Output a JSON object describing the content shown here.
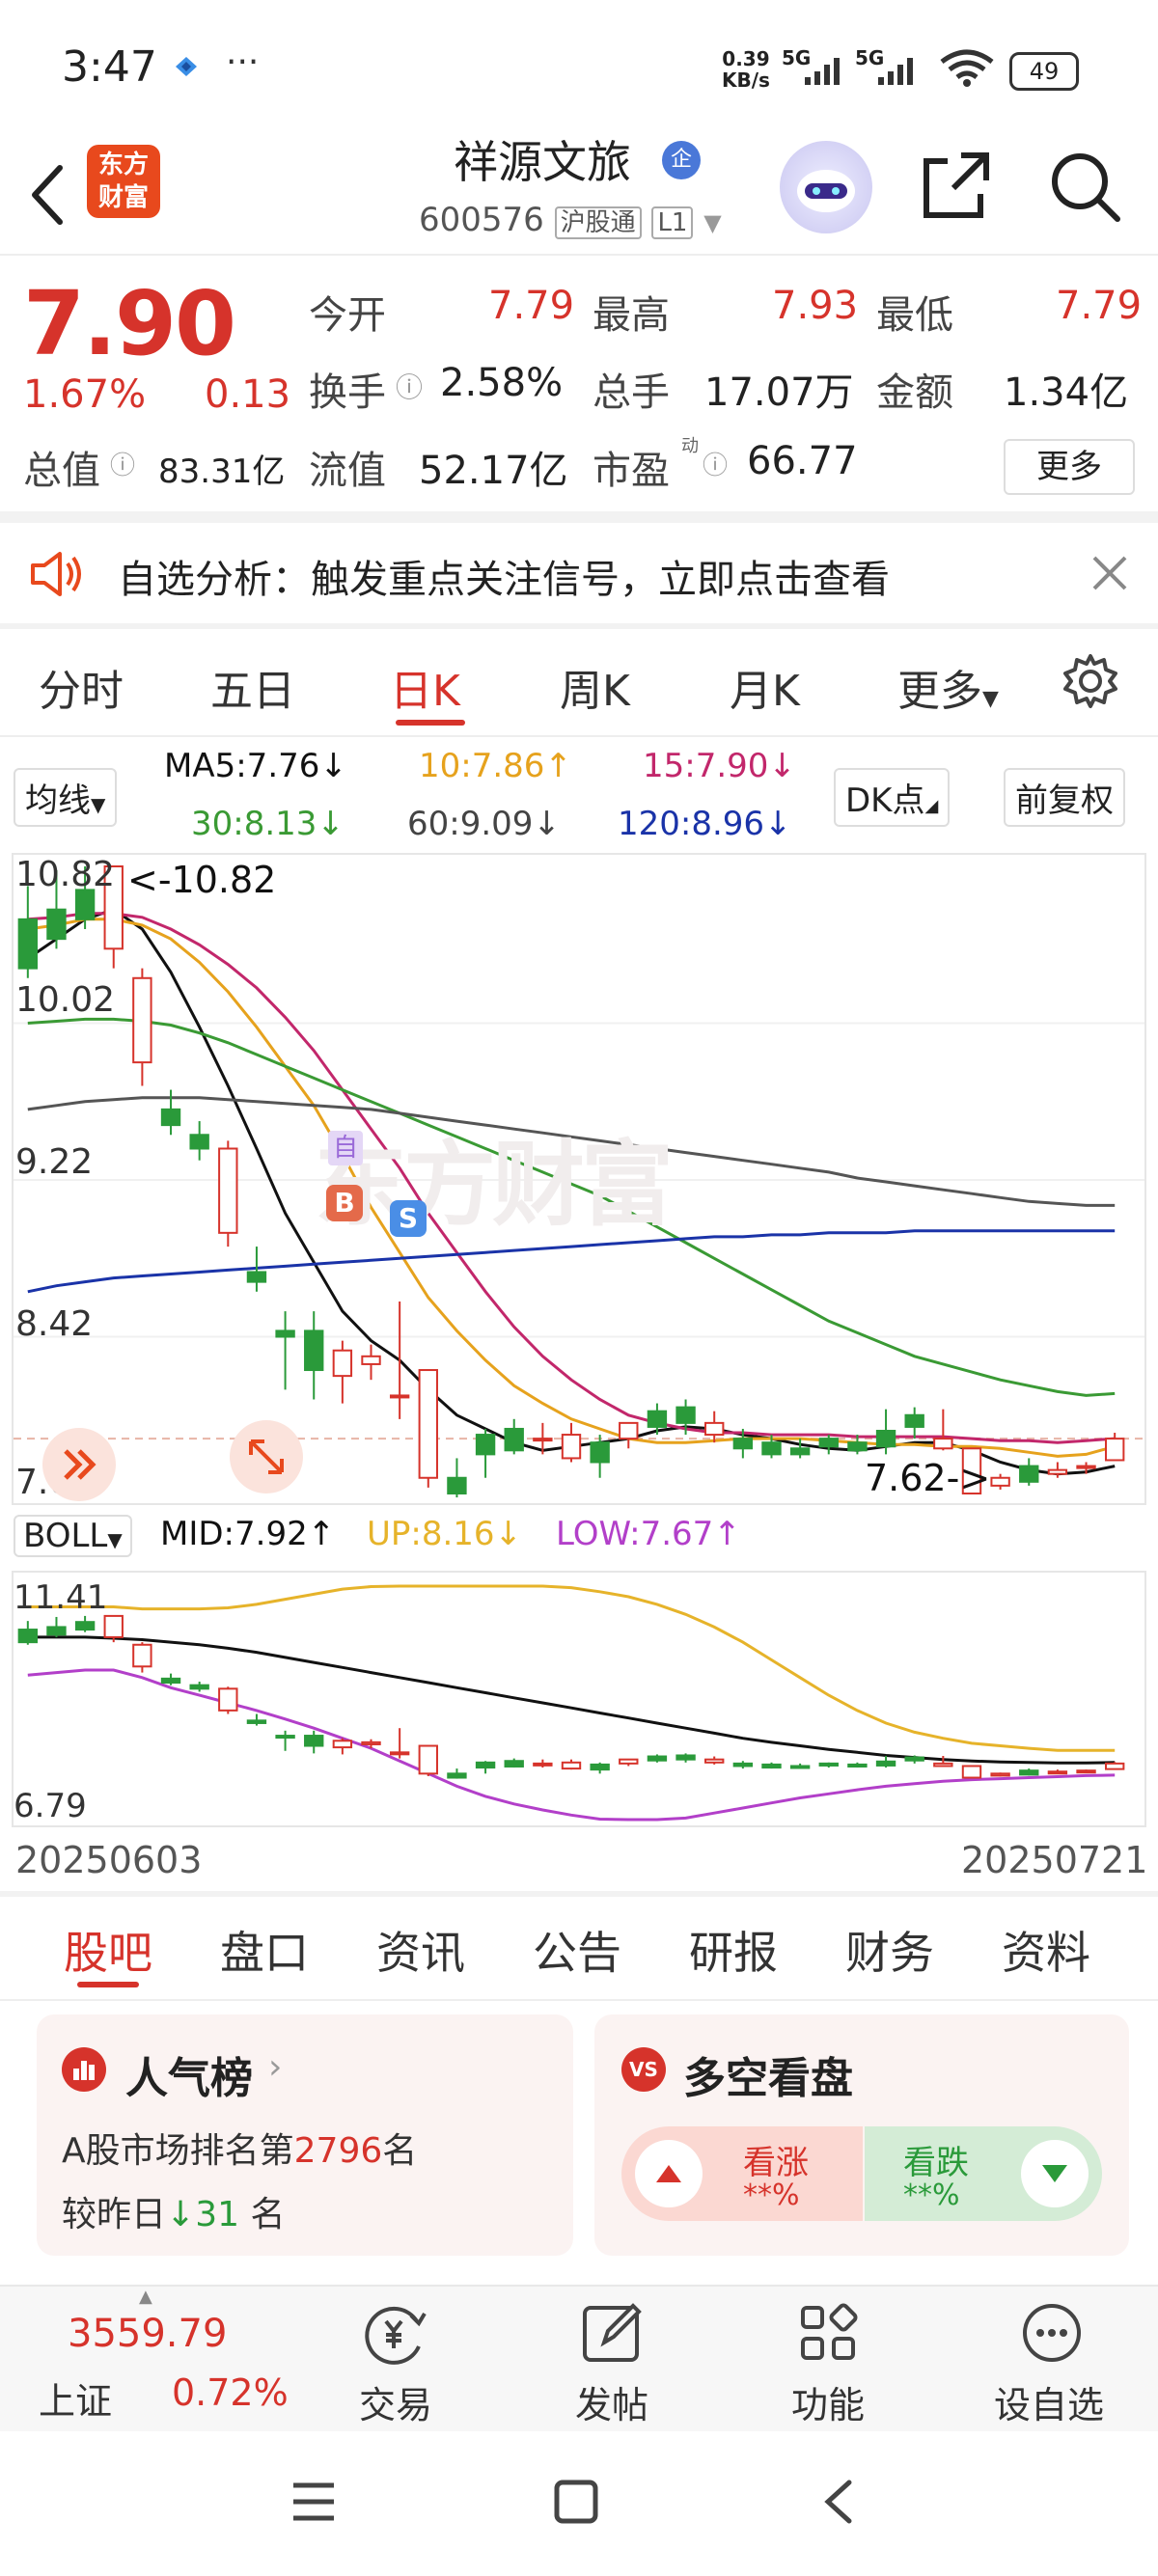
{
  "status_bar": {
    "time": "3:47",
    "dots": "···",
    "net_speed_top": "0.39",
    "net_speed_bottom": "KB/s",
    "sig1": "5G",
    "sig2": "5G",
    "battery": "49"
  },
  "header": {
    "logo_line1": "东方",
    "logo_line2": "财富",
    "title": "祥源文旅",
    "title_badge": "企",
    "code": "600576",
    "tag1": "沪股通",
    "tag2": "L1"
  },
  "quote": {
    "price": "7.90",
    "change_pct": "1.67%",
    "change": "0.13",
    "open_label": "今开",
    "open": "7.79",
    "high_label": "最高",
    "high": "7.93",
    "low_label": "最低",
    "low": "7.79",
    "turnover_label": "换手",
    "turnover": "2.58%",
    "volume_label": "总手",
    "volume": "17.07万",
    "amount_label": "金额",
    "amount": "1.34亿",
    "mktcap_label": "总值",
    "mktcap": "83.31亿",
    "float_label": "流值",
    "float_cap": "52.17亿",
    "pe_label": "市盈",
    "pe_sup": "动",
    "pe": "66.77",
    "more": "更多"
  },
  "banner": {
    "text": "自选分析：触发重点关注信号，立即点击查看"
  },
  "period_tabs": [
    "分时",
    "五日",
    "日K",
    "周K",
    "月K",
    "更多"
  ],
  "period_active": 2,
  "ma_legend": {
    "selector": "均线",
    "ma5": "MA5:7.76↓",
    "ma10": "10:7.86↑",
    "ma15": "15:7.90↓",
    "ma30": "30:8.13↓",
    "ma60": "60:9.09↓",
    "ma120": "120:8.96↓",
    "dk": "DK点",
    "adjust": "前复权"
  },
  "chart_data": [
    {
      "type": "candlestick",
      "y_labels": [
        "10.82",
        "10.02",
        "9.22",
        "8.42",
        "7.62"
      ],
      "ylim": [
        7.62,
        10.82
      ],
      "max_annotation": "<-10.82",
      "min_annotation": "7.62->",
      "watermark": "东方财富",
      "markers": {
        "b": "B",
        "s": "S",
        "zi": "自"
      },
      "candles": [
        [
          10.55,
          10.3,
          10.72,
          10.25
        ],
        [
          10.6,
          10.45,
          10.8,
          10.4
        ],
        [
          10.7,
          10.55,
          10.82,
          10.5
        ],
        [
          10.4,
          10.82,
          10.82,
          10.3
        ],
        [
          9.82,
          10.25,
          10.3,
          9.7
        ],
        [
          9.58,
          9.5,
          9.68,
          9.45
        ],
        [
          9.45,
          9.38,
          9.52,
          9.32
        ],
        [
          8.95,
          9.38,
          9.42,
          8.88
        ],
        [
          8.75,
          8.7,
          8.88,
          8.65
        ],
        [
          8.45,
          8.42,
          8.55,
          8.15
        ],
        [
          8.45,
          8.25,
          8.55,
          8.1
        ],
        [
          8.22,
          8.35,
          8.4,
          8.08
        ],
        [
          8.28,
          8.32,
          8.38,
          8.2
        ],
        [
          8.12,
          8.12,
          8.6,
          8.0
        ],
        [
          7.7,
          8.25,
          8.25,
          7.65
        ],
        [
          7.7,
          7.62,
          7.8,
          7.6
        ],
        [
          7.92,
          7.82,
          7.95,
          7.7
        ],
        [
          7.95,
          7.84,
          8.0,
          7.82
        ],
        [
          7.9,
          7.9,
          7.98,
          7.82
        ],
        [
          7.8,
          7.92,
          7.98,
          7.78
        ],
        [
          7.88,
          7.78,
          7.92,
          7.7
        ],
        [
          7.9,
          7.98,
          7.98,
          7.85
        ],
        [
          8.04,
          7.96,
          8.08,
          7.92
        ],
        [
          8.06,
          7.98,
          8.1,
          7.92
        ],
        [
          7.92,
          7.98,
          8.04,
          7.88
        ],
        [
          7.9,
          7.85,
          7.95,
          7.8
        ],
        [
          7.88,
          7.82,
          7.92,
          7.8
        ],
        [
          7.85,
          7.82,
          7.9,
          7.8
        ],
        [
          7.9,
          7.86,
          7.92,
          7.82
        ],
        [
          7.88,
          7.84,
          7.92,
          7.82
        ],
        [
          7.94,
          7.86,
          8.05,
          7.82
        ],
        [
          8.02,
          7.96,
          8.06,
          7.9
        ],
        [
          7.85,
          7.9,
          8.05,
          7.84
        ],
        [
          7.62,
          7.85,
          7.85,
          7.62
        ],
        [
          7.66,
          7.7,
          7.72,
          7.64
        ],
        [
          7.76,
          7.68,
          7.8,
          7.66
        ],
        [
          7.72,
          7.74,
          7.78,
          7.7
        ],
        [
          7.75,
          7.76,
          7.78,
          7.72
        ],
        [
          7.79,
          7.9,
          7.93,
          7.79
        ]
      ],
      "ma_series": [
        {
          "name": "MA5",
          "color": "#111111",
          "values": [
            10.35,
            10.45,
            10.55,
            10.6,
            10.5,
            10.28,
            10.0,
            9.7,
            9.38,
            9.05,
            8.8,
            8.55,
            8.4,
            8.3,
            8.15,
            8.02,
            7.95,
            7.88,
            7.84,
            7.86,
            7.88,
            7.9,
            7.94,
            7.96,
            7.95,
            7.92,
            7.9,
            7.87,
            7.85,
            7.84,
            7.86,
            7.88,
            7.88,
            7.84,
            7.78,
            7.74,
            7.72,
            7.73,
            7.76
          ]
        },
        {
          "name": "MA10",
          "color": "#e6a21d",
          "values": [
            10.5,
            10.52,
            10.55,
            10.55,
            10.52,
            10.45,
            10.33,
            10.18,
            10.0,
            9.8,
            9.6,
            9.35,
            9.08,
            8.85,
            8.62,
            8.45,
            8.3,
            8.17,
            8.08,
            8.0,
            7.95,
            7.9,
            7.88,
            7.88,
            7.89,
            7.9,
            7.9,
            7.9,
            7.89,
            7.88,
            7.87,
            7.87,
            7.86,
            7.86,
            7.85,
            7.83,
            7.81,
            7.82,
            7.86
          ]
        },
        {
          "name": "MA15",
          "color": "#c2276b",
          "values": [
            10.55,
            10.56,
            10.58,
            10.58,
            10.56,
            10.5,
            10.42,
            10.32,
            10.2,
            10.05,
            9.88,
            9.68,
            9.48,
            9.28,
            9.05,
            8.85,
            8.65,
            8.47,
            8.32,
            8.2,
            8.1,
            8.02,
            7.98,
            7.95,
            7.93,
            7.93,
            7.92,
            7.92,
            7.92,
            7.91,
            7.91,
            7.91,
            7.91,
            7.9,
            7.89,
            7.89,
            7.88,
            7.89,
            7.9
          ]
        },
        {
          "name": "MA30",
          "color": "#3a9a34",
          "values": [
            10.02,
            10.03,
            10.04,
            10.04,
            10.03,
            10.01,
            9.97,
            9.92,
            9.86,
            9.8,
            9.74,
            9.68,
            9.62,
            9.56,
            9.5,
            9.44,
            9.38,
            9.32,
            9.26,
            9.2,
            9.14,
            9.06,
            8.98,
            8.9,
            8.82,
            8.74,
            8.66,
            8.58,
            8.5,
            8.44,
            8.38,
            8.32,
            8.28,
            8.24,
            8.2,
            8.17,
            8.14,
            8.12,
            8.13
          ]
        },
        {
          "name": "MA60",
          "color": "#555555",
          "values": [
            9.58,
            9.6,
            9.62,
            9.63,
            9.64,
            9.64,
            9.64,
            9.63,
            9.62,
            9.61,
            9.6,
            9.59,
            9.58,
            9.56,
            9.54,
            9.52,
            9.5,
            9.48,
            9.46,
            9.44,
            9.42,
            9.4,
            9.38,
            9.36,
            9.34,
            9.32,
            9.3,
            9.28,
            9.26,
            9.23,
            9.21,
            9.19,
            9.17,
            9.15,
            9.13,
            9.11,
            9.1,
            9.09,
            9.09
          ]
        },
        {
          "name": "MA120",
          "color": "#1a33a8",
          "values": [
            8.65,
            8.68,
            8.7,
            8.72,
            8.73,
            8.74,
            8.75,
            8.76,
            8.77,
            8.78,
            8.79,
            8.8,
            8.81,
            8.82,
            8.83,
            8.84,
            8.85,
            8.86,
            8.87,
            8.88,
            8.89,
            8.9,
            8.91,
            8.92,
            8.93,
            8.93,
            8.94,
            8.94,
            8.95,
            8.95,
            8.95,
            8.96,
            8.96,
            8.96,
            8.96,
            8.96,
            8.96,
            8.96,
            8.96
          ]
        }
      ]
    },
    {
      "type": "line",
      "indicator": "BOLL",
      "y_labels": [
        "11.41",
        "6.79"
      ],
      "ylim": [
        6.79,
        11.41
      ],
      "legend": {
        "selector": "BOLL",
        "mid": "MID:7.92↑",
        "up": "UP:8.16↓",
        "low": "LOW:7.67↑"
      },
      "series": [
        {
          "name": "UP",
          "color": "#e6b32a",
          "values": [
            11.0,
            11.0,
            11.0,
            11.0,
            10.96,
            10.96,
            10.96,
            10.98,
            11.05,
            11.15,
            11.25,
            11.35,
            11.4,
            11.41,
            11.41,
            11.41,
            11.41,
            11.41,
            11.41,
            11.38,
            11.3,
            11.2,
            11.05,
            10.85,
            10.6,
            10.3,
            9.95,
            9.6,
            9.25,
            8.95,
            8.7,
            8.52,
            8.4,
            8.3,
            8.25,
            8.2,
            8.16,
            8.16,
            8.16
          ]
        },
        {
          "name": "MID",
          "color": "#111111",
          "values": [
            10.4,
            10.4,
            10.4,
            10.38,
            10.35,
            10.3,
            10.25,
            10.18,
            10.1,
            10.0,
            9.9,
            9.8,
            9.7,
            9.6,
            9.5,
            9.4,
            9.3,
            9.2,
            9.1,
            9.0,
            8.9,
            8.8,
            8.7,
            8.6,
            8.5,
            8.4,
            8.32,
            8.25,
            8.18,
            8.12,
            8.06,
            8.02,
            7.98,
            7.95,
            7.93,
            7.92,
            7.91,
            7.91,
            7.92
          ]
        },
        {
          "name": "LOW",
          "color": "#b23fc9",
          "values": [
            9.65,
            9.7,
            9.75,
            9.75,
            9.6,
            9.4,
            9.25,
            9.1,
            8.95,
            8.78,
            8.6,
            8.4,
            8.2,
            7.95,
            7.7,
            7.45,
            7.25,
            7.1,
            6.98,
            6.88,
            6.8,
            6.79,
            6.79,
            6.82,
            6.92,
            7.02,
            7.12,
            7.22,
            7.3,
            7.38,
            7.45,
            7.5,
            7.55,
            7.58,
            7.6,
            7.62,
            7.64,
            7.66,
            7.67
          ]
        }
      ],
      "candles_scaled": true
    }
  ],
  "x_range": {
    "start": "20250603",
    "end": "20250721"
  },
  "sub_tabs": [
    "股吧",
    "盘口",
    "资讯",
    "公告",
    "研报",
    "财务",
    "资料"
  ],
  "popularity": {
    "title": "人气榜",
    "rank_prefix": "A股市场排名第",
    "rank": "2796",
    "rank_suffix": "名",
    "vs_prefix": "较昨日",
    "vs_arrow": "↓",
    "vs_value": "31",
    "vs_suffix": "名"
  },
  "bull_bear": {
    "badge": "VS",
    "title": "多空看盘",
    "up_label": "看涨",
    "up_value": "**%",
    "down_label": "看跌",
    "down_value": "**%"
  },
  "bottom_nav": {
    "index_value": "3559.79",
    "index_name": "上证",
    "index_change": "0.72%",
    "trade": "交易",
    "post": "发帖",
    "function": "功能",
    "watch": "设自选"
  },
  "colors": {
    "up": "#d6332b",
    "down": "#2a9a3a",
    "accent": "#d6332b"
  }
}
